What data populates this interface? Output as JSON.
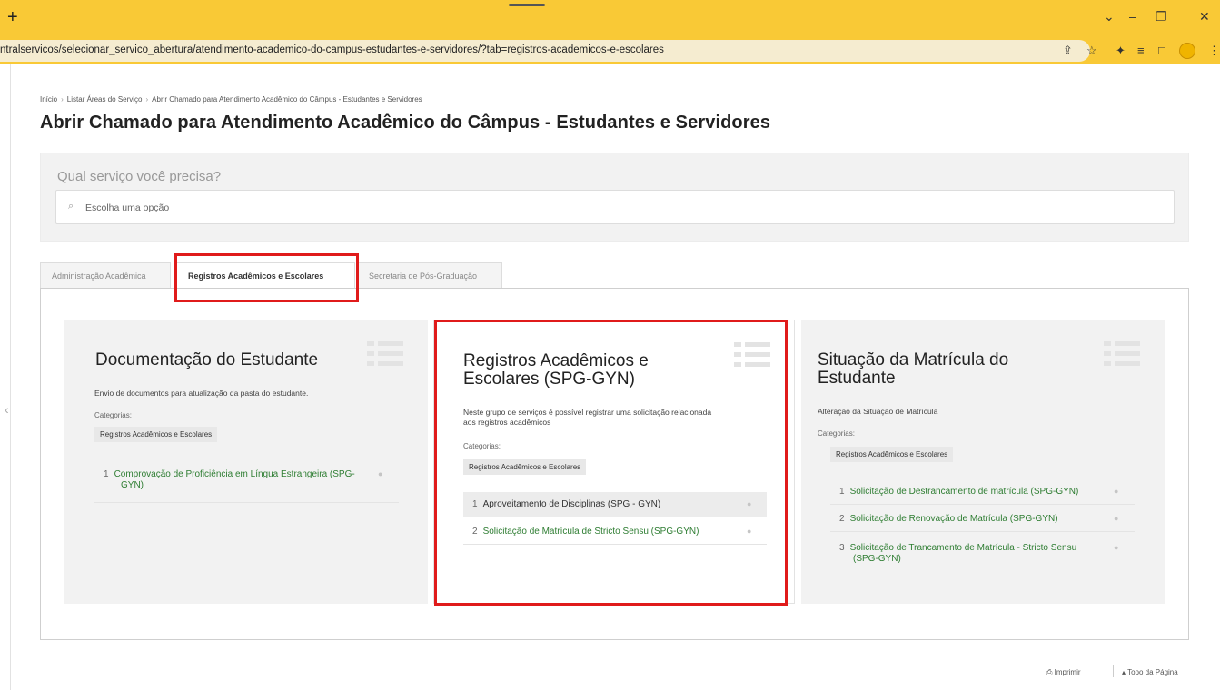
{
  "browser": {
    "new_tab_glyph": "+",
    "url": "ntralservicos/selecionar_servico_abertura/atendimento-academico-do-campus-estudantes-e-servidores/?tab=registros-academicos-e-escolares",
    "controls": {
      "minimize": "–",
      "restore": "❐",
      "close": "✕",
      "dropdown": "⌄"
    },
    "toolbar_icons": [
      "share-icon",
      "star-icon",
      "extensions-icon",
      "reading-list-icon",
      "side-panel-icon",
      "profile-icon",
      "menu-icon"
    ]
  },
  "breadcrumb": {
    "items": [
      "Início",
      "Listar Áreas do Serviço",
      "Abrir Chamado para Atendimento Acadêmico do Câmpus - Estudantes e Servidores"
    ],
    "separator": "›"
  },
  "page_title": "Abrir Chamado para Atendimento Acadêmico do Câmpus - Estudantes e Servidores",
  "search": {
    "question": "Qual serviço você precisa?",
    "placeholder": "Escolha uma opção"
  },
  "tabs": [
    {
      "label": "Administração Acadêmica",
      "active": false
    },
    {
      "label": "Registros Acadêmicos e Escolares",
      "active": true
    },
    {
      "label": "Secretaria de Pós-Graduação",
      "active": false
    }
  ],
  "categories_label": "Categorias:",
  "cards": [
    {
      "title": "Documentação do Estudante",
      "description": "Envio de documentos para atualização da pasta do estudante.",
      "category": "Registros Acadêmicos e Escolares",
      "services": [
        {
          "num": "1",
          "label": "Comprovação de Proficiência em Língua Estrangeira (SPG-",
          "label2": "GYN)"
        }
      ]
    },
    {
      "title": "Registros Acadêmicos e",
      "title2": "Escolares (SPG-GYN)",
      "description": "Neste grupo de serviços é possível registrar uma solicitação relacionada",
      "description2": "aos registros acadêmicos",
      "category": "Registros Acadêmicos e Escolares",
      "services": [
        {
          "num": "1",
          "label": "Aproveitamento de Disciplinas (SPG - GYN)"
        },
        {
          "num": "2",
          "label": "Solicitação de Matrícula de Stricto Sensu (SPG-GYN)"
        }
      ]
    },
    {
      "title": "Situação da Matrícula do",
      "title2": "Estudante",
      "description": "Alteração da Situação de Matrícula",
      "category": "Registros Acadêmicos e Escolares",
      "services": [
        {
          "num": "1",
          "label": "Solicitação de Destrancamento de matrícula (SPG-GYN)"
        },
        {
          "num": "2",
          "label": "Solicitação de Renovação de Matrícula (SPG-GYN)"
        },
        {
          "num": "3",
          "label": "Solicitação de Trancamento de Matrícula - Stricto Sensu",
          "label2": "(SPG-GYN)"
        }
      ]
    }
  ],
  "footer": {
    "print": "Imprimir",
    "top": "Topo da Página"
  },
  "colors": {
    "browser_chrome": "#f9c936",
    "highlight_box": "#e01b1b",
    "service_link": "#2e7d32"
  }
}
